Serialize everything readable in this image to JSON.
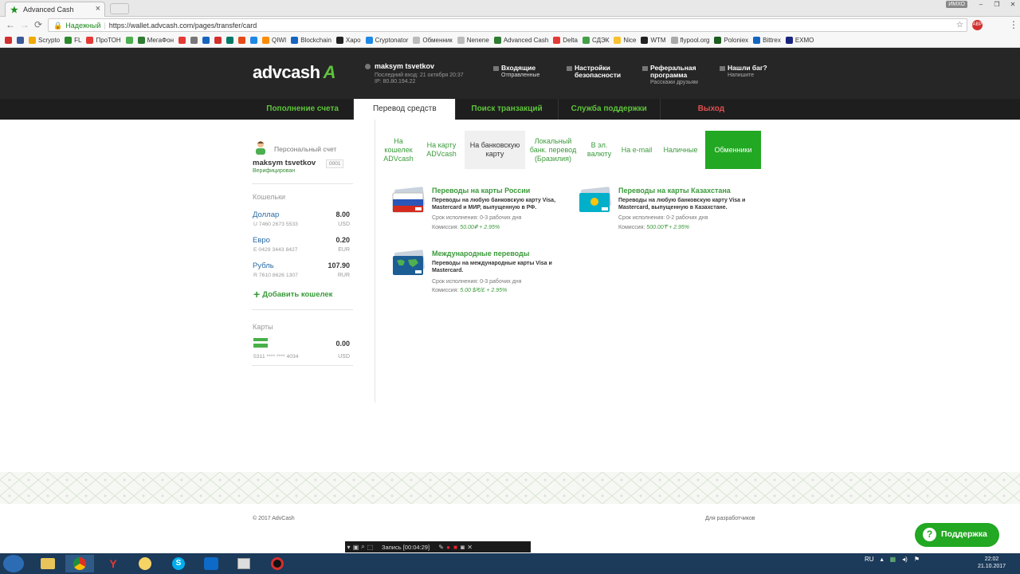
{
  "browser": {
    "tab_title": "Advanced Cash",
    "secure_label": "Надежный",
    "url": "https://wallet.advcash.com/pages/transfer/card",
    "user_badge": "ИМХО",
    "bookmarks": [
      {
        "label": "",
        "color": "#d32f2f"
      },
      {
        "label": "",
        "color": "#3b5998"
      },
      {
        "label": "Scrypto",
        "color": "#f2a900"
      },
      {
        "label": "FL",
        "color": "#2b8a2b"
      },
      {
        "label": "ПроТОН",
        "color": "#e53935"
      },
      {
        "label": "",
        "color": "#4caf50"
      },
      {
        "label": "МегаФон",
        "color": "#2e7d32"
      },
      {
        "label": "",
        "color": "#e53935"
      },
      {
        "label": "",
        "color": "#777777"
      },
      {
        "label": "",
        "color": "#1565c0"
      },
      {
        "label": "",
        "color": "#d32f2f"
      },
      {
        "label": "",
        "color": "#00796b"
      },
      {
        "label": "",
        "color": "#e64a19"
      },
      {
        "label": "",
        "color": "#1e88e5"
      },
      {
        "label": "QIWI",
        "color": "#ff8c00"
      },
      {
        "label": "Blockchain",
        "color": "#1565c0"
      },
      {
        "label": "Xapo",
        "color": "#222222"
      },
      {
        "label": "Cryptonator",
        "color": "#1e88e5"
      },
      {
        "label": "Обменник",
        "color": "#bbbbbb"
      },
      {
        "label": "Nenene",
        "color": "#bbbbbb"
      },
      {
        "label": "Advanced Cash",
        "color": "#2e7d32"
      },
      {
        "label": "Delta",
        "color": "#e53935"
      },
      {
        "label": "СДЭК",
        "color": "#43a047"
      },
      {
        "label": "Nice",
        "color": "#fbc02d"
      },
      {
        "label": "WTM",
        "color": "#222222"
      },
      {
        "label": "flypool.org",
        "color": "#aaaaaa"
      },
      {
        "label": "Poloniex",
        "color": "#1b5e20"
      },
      {
        "label": "Bittrex",
        "color": "#1565c0"
      },
      {
        "label": "EXMO",
        "color": "#1a237e"
      }
    ]
  },
  "header": {
    "logo_text": "advcash",
    "user_name": "maksym tsvetkov",
    "last_login": "Последний вход: 21 октября 20:37",
    "ip": "IP: 80.80.194.22",
    "links": [
      {
        "title": "Входящие",
        "sub": "Отправленные"
      },
      {
        "title": "Настройки безопасности",
        "sub": ""
      },
      {
        "title": "Реферальная программа",
        "sub": "Расскажи друзьям"
      },
      {
        "title": "Нашли баг?",
        "sub": "Напишите"
      }
    ]
  },
  "nav": [
    "Пополнение счета",
    "Перевод средств",
    "Поиск транзакций",
    "Служба поддержки",
    "Выход"
  ],
  "sidebar": {
    "personal_account": "Персональный счет",
    "name": "maksym tsvetkov",
    "verified": "Верифицирован",
    "id_badge": "0001",
    "wallets_heading": "Кошельки",
    "wallets": [
      {
        "name": "Доллар",
        "number": "U 7460 2673 5533",
        "amount": "8.00",
        "currency": "USD"
      },
      {
        "name": "Евро",
        "number": "E 0429 3443 8427",
        "amount": "0.20",
        "currency": "EUR"
      },
      {
        "name": "Рубль",
        "number": "R 7610 8626 1307",
        "amount": "107.90",
        "currency": "RUR"
      }
    ],
    "add_wallet": "Добавить кошелек",
    "cards_heading": "Карты",
    "card": {
      "number": "5311 **** **** 4034",
      "amount": "0.00",
      "currency": "USD"
    }
  },
  "subtabs": [
    "На кошелек ADVcash",
    "На карту ADVcash",
    "На банковскую карту",
    "Локальный банк. перевод (Бразилия)",
    "В эл. валюту",
    "На e-mail",
    "Наличные",
    "Обменники"
  ],
  "options": [
    {
      "title": "Переводы на карты России",
      "desc": "Переводы на любую банковскую карту Visa, Mastercard и МИР, выпущенную в РФ.",
      "term": "Срок исполнения: 0-3 рабочих дня",
      "commission_label": "Комиссия:",
      "commission": "50.00₽ + 2.95%"
    },
    {
      "title": "Переводы на карты Казахстана",
      "desc": "Переводы на любую банковскую карту Visa и Mastercard, выпущенную в Казахстане.",
      "term": "Срок исполнения: 0-2 рабочих дня",
      "commission_label": "Комиссия:",
      "commission": "500.00₸ + 2.95%"
    },
    {
      "title": "Международные переводы",
      "desc": "Переводы на международные карты Visa и Mastercard.",
      "term": "Срок исполнения: 0-3 рабочих дня",
      "commission_label": "Комиссия:",
      "commission": "5.00 $/€/£ + 2.95%"
    }
  ],
  "footer": {
    "copyright": "© 2017 AdvCash",
    "developers": "Для разработчиков",
    "support": "Поддержка"
  },
  "recorder": {
    "label": "Запись [00:04:29]"
  },
  "tray": {
    "lang": "RU",
    "time": "22:02",
    "date": "21.10.2017"
  }
}
